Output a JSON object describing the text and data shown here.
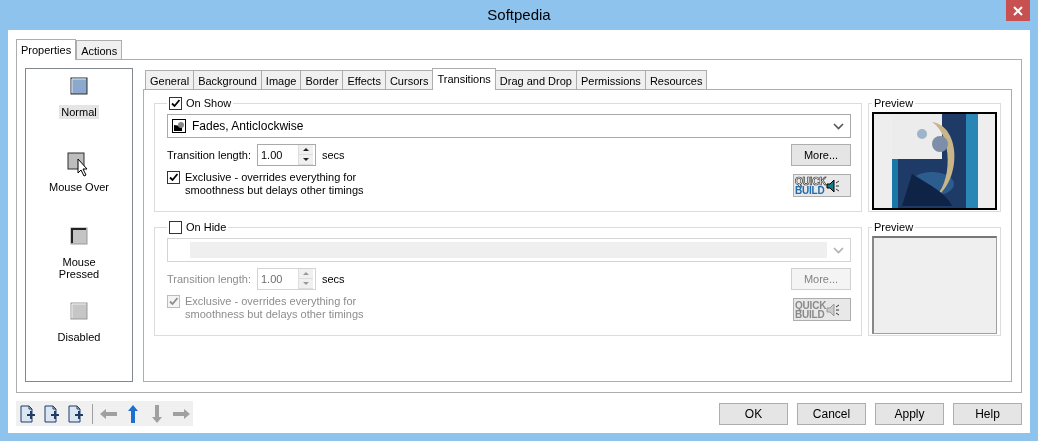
{
  "window": {
    "title": "Softpedia"
  },
  "outer_tabs": [
    {
      "label": "Properties",
      "selected": true
    },
    {
      "label": "Actions",
      "selected": false
    }
  ],
  "states": [
    {
      "kind": "normal",
      "label": "Normal",
      "selected": true
    },
    {
      "kind": "mouse_over",
      "label": "Mouse Over",
      "selected": false
    },
    {
      "kind": "pressed",
      "label": "Mouse Pressed",
      "selected": false
    },
    {
      "kind": "disabled",
      "label": "Disabled",
      "selected": false
    }
  ],
  "inner_tabs": [
    {
      "label": "General",
      "selected": false
    },
    {
      "label": "Background",
      "selected": false
    },
    {
      "label": "Image",
      "selected": false
    },
    {
      "label": "Border",
      "selected": false
    },
    {
      "label": "Effects",
      "selected": false
    },
    {
      "label": "Cursors",
      "selected": false
    },
    {
      "label": "Transitions",
      "selected": true
    },
    {
      "label": "Drag and Drop",
      "selected": false
    },
    {
      "label": "Permissions",
      "selected": false
    },
    {
      "label": "Resources",
      "selected": false
    }
  ],
  "sections": [
    {
      "label": "On Show",
      "checked": true,
      "disabled": false,
      "transition": "Fades, Anticlockwise",
      "length_label": "Transition length:",
      "length": "1.00",
      "unit": "secs",
      "more_button": "More...",
      "exclusive": {
        "label": "Exclusive - overrides everything for smoothness but delays other timings",
        "checked": true
      },
      "quick_build": [
        "QUICK",
        "BUILD"
      ],
      "preview": {
        "title": "Preview",
        "kind": "picture"
      }
    },
    {
      "label": "On Hide",
      "checked": false,
      "disabled": true,
      "length_label": "Transition length:",
      "length": "1.00",
      "unit": "secs",
      "more_button": "More...",
      "exclusive": {
        "label": "Exclusive - overrides everything for smoothness but delays other timings",
        "checked": true
      },
      "quick_build": [
        "QUICK",
        "BUILD"
      ],
      "preview": {
        "title": "Preview",
        "kind": "empty"
      }
    }
  ],
  "toolbar": [
    {
      "kind": "doc"
    },
    {
      "kind": "doc"
    },
    {
      "kind": "doc"
    },
    {
      "kind": "separator"
    },
    {
      "kind": "left",
      "disabled": true
    },
    {
      "kind": "up",
      "disabled": false
    },
    {
      "kind": "down",
      "disabled": true
    },
    {
      "kind": "right",
      "disabled": true
    }
  ],
  "buttons": [
    "OK",
    "Cancel",
    "Apply",
    "Help"
  ]
}
